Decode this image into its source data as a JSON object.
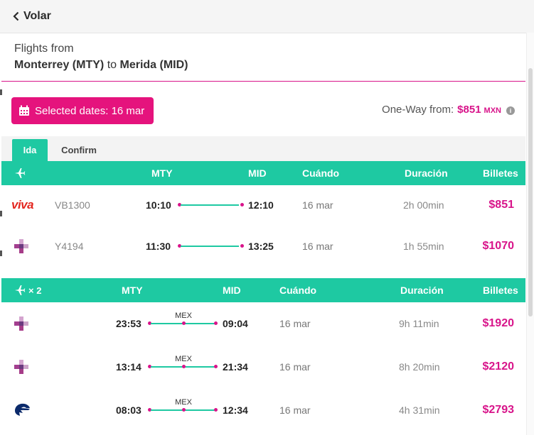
{
  "topbar": {
    "back_label": "Volar"
  },
  "route": {
    "line1": "Flights from",
    "origin": "Monterrey (MTY)",
    "connector": "to",
    "destination": "Merida (MID)"
  },
  "dates_button": {
    "label": "Selected dates: 16 mar"
  },
  "oneway": {
    "label": "One-Way from:",
    "price": "$851",
    "currency": "MXN",
    "info": "i"
  },
  "tabs": [
    {
      "label": "Ida",
      "active": true
    },
    {
      "label": "Confirm",
      "active": false
    }
  ],
  "direct": {
    "header": {
      "from": "MTY",
      "to": "MID",
      "when": "Cuándo",
      "duration": "Duración",
      "tickets": "Billetes"
    },
    "flights": [
      {
        "airline_logo": "VivaAerobus",
        "logo_text": "viva",
        "flight": "VB1300",
        "depart": "10:10",
        "arrive": "12:10",
        "date": "16 mar",
        "duration": "2h 00min",
        "price": "$851"
      },
      {
        "airline_logo": "Volaris",
        "flight": "Y4194",
        "depart": "11:30",
        "arrive": "13:25",
        "date": "16 mar",
        "duration": "1h 55min",
        "price": "$1070"
      }
    ]
  },
  "connecting": {
    "header": {
      "stops": "× 2",
      "from": "MTY",
      "to": "MID",
      "when": "Cuándo",
      "duration": "Duración",
      "tickets": "Billetes"
    },
    "flights": [
      {
        "airline_logo": "Volaris",
        "depart": "23:53",
        "stop": "MEX",
        "arrive": "09:04",
        "date": "16 mar",
        "duration": "9h 11min",
        "price": "$1920"
      },
      {
        "airline_logo": "Volaris",
        "depart": "13:14",
        "stop": "MEX",
        "arrive": "21:34",
        "date": "16 mar",
        "duration": "8h 20min",
        "price": "$2120"
      },
      {
        "airline_logo": "Aeromexico",
        "depart": "08:03",
        "stop": "MEX",
        "arrive": "12:34",
        "date": "16 mar",
        "duration": "4h 31min",
        "price": "$2793"
      }
    ]
  },
  "colors": {
    "accent": "#1ec9a2",
    "brand": "#e5137d",
    "price": "#d8148a"
  }
}
